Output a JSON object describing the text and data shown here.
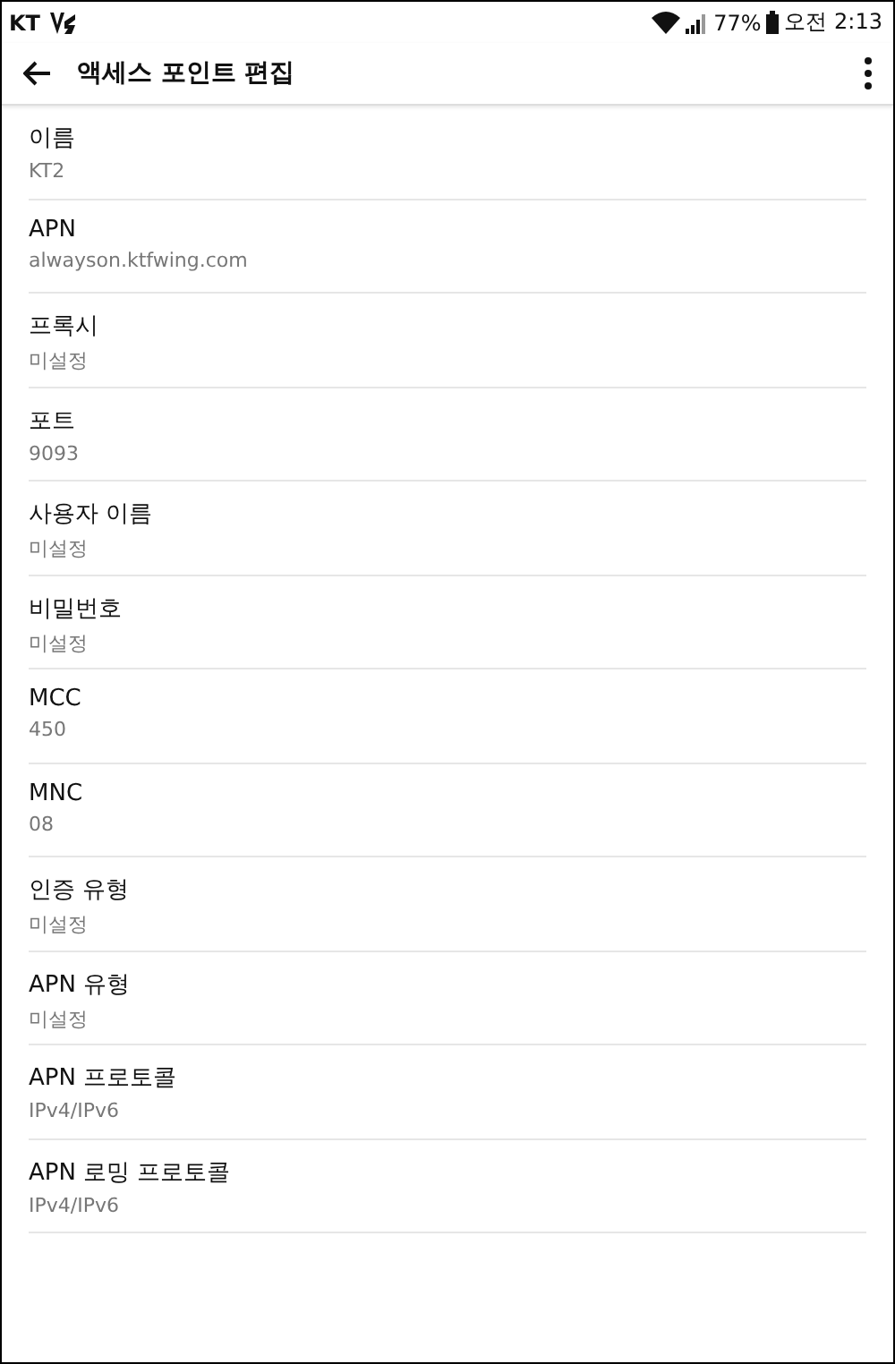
{
  "status_bar": {
    "carrier": "KT",
    "battery": "77%",
    "time": "오전 2:13"
  },
  "toolbar": {
    "title": "액세스 포인트 편집"
  },
  "settings": [
    {
      "label": "이름",
      "value": "KT2"
    },
    {
      "label": "APN",
      "value": "alwayson.ktfwing.com"
    },
    {
      "label": "프록시",
      "value": "미설정"
    },
    {
      "label": "포트",
      "value": "9093"
    },
    {
      "label": "사용자 이름",
      "value": "미설정"
    },
    {
      "label": "비밀번호",
      "value": "미설정"
    },
    {
      "label": "MCC",
      "value": "450"
    },
    {
      "label": "MNC",
      "value": "08"
    },
    {
      "label": "인증 유형",
      "value": "미설정"
    },
    {
      "label": "APN 유형",
      "value": "미설정"
    },
    {
      "label": "APN 프로토콜",
      "value": "IPv4/IPv6"
    },
    {
      "label": "APN 로밍 프로토콜",
      "value": "IPv4/IPv6"
    }
  ]
}
